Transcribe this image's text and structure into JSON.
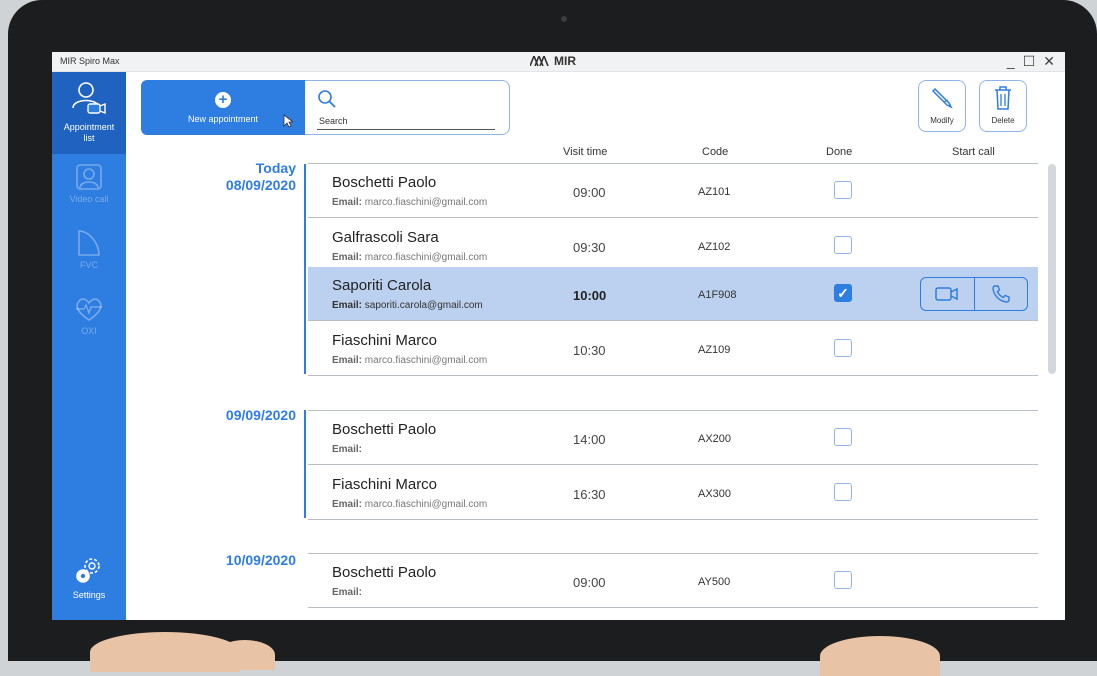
{
  "window": {
    "title": "MIR Spiro Max",
    "brand": "MIR",
    "controls": [
      "_",
      "☐",
      "✕"
    ]
  },
  "sidebar": {
    "items": [
      {
        "label": "Appointment list",
        "icon": "appointment-list-icon",
        "active": true
      },
      {
        "label": "Video call",
        "icon": "video-call-icon",
        "active": false
      },
      {
        "label": "FVC",
        "icon": "fvc-icon",
        "active": false
      },
      {
        "label": "OXI",
        "icon": "oxi-icon",
        "active": false
      },
      {
        "label": "Settings",
        "icon": "settings-icon",
        "active": false
      }
    ]
  },
  "toolbar": {
    "new_label": "New appointment",
    "search_label": "Search",
    "modify_label": "Modify",
    "delete_label": "Delete"
  },
  "columns": {
    "visit_time": "Visit time",
    "code": "Code",
    "done": "Done",
    "start_call": "Start call"
  },
  "groups": [
    {
      "today_label": "Today",
      "date": "08/09/2020"
    },
    {
      "today_label": "",
      "date": "09/09/2020"
    },
    {
      "today_label": "",
      "date": "10/09/2020"
    }
  ],
  "rows": [
    {
      "name": "Boschetti Paolo",
      "email_label": "Email:",
      "email": "marco.fiaschini@gmail.com",
      "time": "09:00",
      "code": "AZ101",
      "done": false,
      "selected": false
    },
    {
      "name": "Galfrascoli Sara",
      "email_label": "Email:",
      "email": "marco.fiaschini@gmail.com",
      "time": "09:30",
      "code": "AZ102",
      "done": false,
      "selected": false
    },
    {
      "name": "Saporiti Carola",
      "email_label": "Email:",
      "email": "saporiti.carola@gmail.com",
      "time": "10:00",
      "code": "A1F908",
      "done": true,
      "selected": true
    },
    {
      "name": "Fiaschini Marco",
      "email_label": "Email:",
      "email": "marco.fiaschini@gmail.com",
      "time": "10:30",
      "code": "AZ109",
      "done": false,
      "selected": false
    },
    {
      "name": "Boschetti Paolo",
      "email_label": "Email:",
      "email": "",
      "time": "14:00",
      "code": "AX200",
      "done": false,
      "selected": false
    },
    {
      "name": "Fiaschini Marco",
      "email_label": "Email:",
      "email": "marco.fiaschini@gmail.com",
      "time": "16:30",
      "code": "AX300",
      "done": false,
      "selected": false
    },
    {
      "name": "Boschetti Paolo",
      "email_label": "Email:",
      "email": "",
      "time": "09:00",
      "code": "AY500",
      "done": false,
      "selected": false
    }
  ],
  "done_check_glyph": "✓",
  "colors": {
    "accent": "#2e7de0",
    "selected_row": "#bcd1ef",
    "sidebar_active": "#1f62bf"
  }
}
